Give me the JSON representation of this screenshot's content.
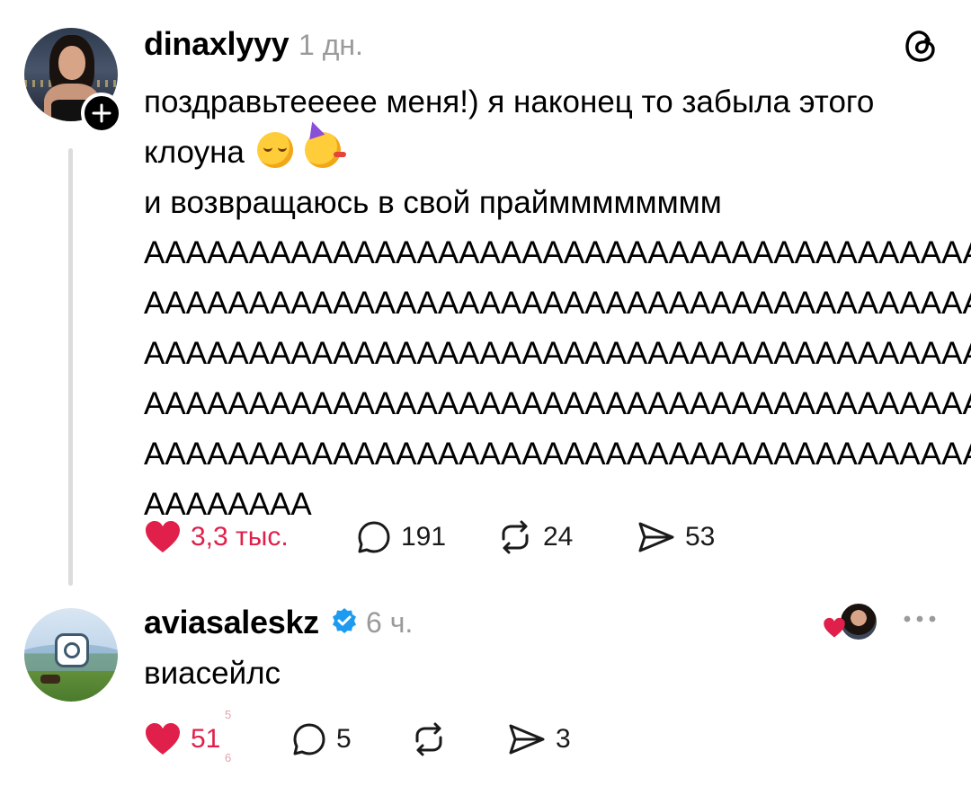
{
  "post": {
    "username": "dinaxlyyy",
    "time": "1 дн.",
    "text_lines": [
      "поздравьтеееее меня!) я наконец то забыла этого",
      "клоуна",
      "и возвращаюсь в свой праймммммммм",
      "АААААААААААААААААААААААААААААААААААААААА",
      "АААААААААААААААААААААААААААААААААААААААА",
      "АААААААААААААААААААААААААААААААААААААААА",
      "АААААААААААААААААААААААААААААААААААААААА",
      "АААААААААААААААААААААААААААААААААААААААА",
      "АААААААА"
    ],
    "emojis": [
      "relieved-face",
      "partying-face"
    ],
    "likes": "3,3 тыс.",
    "comments": "191",
    "reposts": "24",
    "shares": "53"
  },
  "reply": {
    "username": "aviasaleskz",
    "verified": true,
    "time": "6 ч.",
    "text": "виасейлс",
    "likes": "51",
    "comments": "5",
    "shares": "3"
  },
  "colors": {
    "like_red": "#e0204a",
    "muted_gray": "#9a9a9a",
    "verified_blue": "#1d9bf0"
  },
  "icons": {
    "follow": "plus-icon",
    "app": "threads-logo-icon",
    "like": "heart-icon",
    "comment": "comment-bubble-icon",
    "repost": "repost-icon",
    "share": "send-icon",
    "more": "more-dots-icon",
    "verified": "verified-badge-icon"
  }
}
